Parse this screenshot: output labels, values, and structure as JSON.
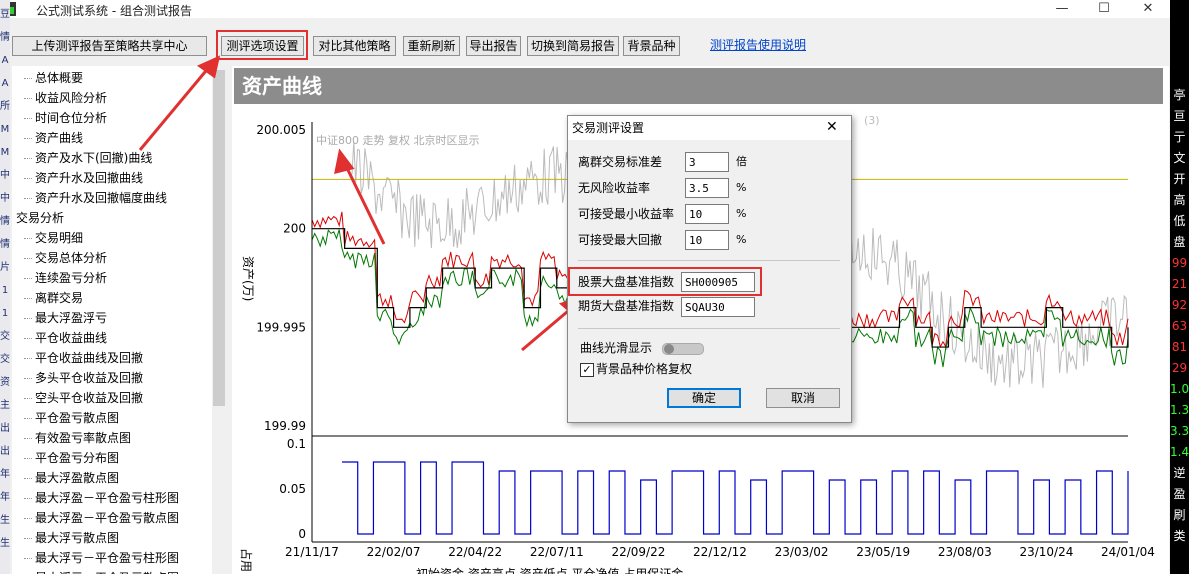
{
  "window": {
    "title": "公式测试系统 - 组合测试报告",
    "controls": {
      "minimize": "—",
      "maximize": "☐",
      "close": "✕"
    }
  },
  "left_strip": [
    "豆",
    "情",
    "A",
    "A",
    "所",
    "M",
    "M",
    "中",
    "中",
    "情",
    "情",
    "片",
    "1",
    "1",
    "交",
    "交",
    "资",
    "主",
    "出",
    "出",
    "年",
    "年",
    "生",
    "生"
  ],
  "right_strip": [
    {
      "t": "亭",
      "c": "#ffffff"
    },
    {
      "t": "亘",
      "c": "#ffffff"
    },
    {
      "t": "亍",
      "c": "#ffffff"
    },
    {
      "t": "文",
      "c": "#ffffff"
    },
    {
      "t": "开",
      "c": "#ffffff"
    },
    {
      "t": "高",
      "c": "#ffffff"
    },
    {
      "t": "低",
      "c": "#ffffff"
    },
    {
      "t": "盘",
      "c": "#ffffff"
    },
    {
      "t": "99",
      "c": "#ff3333"
    },
    {
      "t": "21",
      "c": "#ff3333"
    },
    {
      "t": "92",
      "c": "#ff3333"
    },
    {
      "t": "63",
      "c": "#ff3333"
    },
    {
      "t": "81",
      "c": "#ff3333"
    },
    {
      "t": "29",
      "c": "#ff3333"
    },
    {
      "t": "1.0",
      "c": "#33ff33"
    },
    {
      "t": "1.3",
      "c": "#33ff33"
    },
    {
      "t": "3.3",
      "c": "#33ff33"
    },
    {
      "t": "1.4",
      "c": "#33ff33"
    },
    {
      "t": "逆",
      "c": "#ffffff"
    },
    {
      "t": "盈",
      "c": "#ffffff"
    },
    {
      "t": "刷",
      "c": "#ffffff"
    },
    {
      "t": "类",
      "c": "#ffffff"
    }
  ],
  "toolbar": {
    "upload": "上传测评报告至策略共享中心",
    "options": "测评选项设置",
    "compare": "对比其他策略",
    "refresh": "重新刷新",
    "export": "导出报告",
    "simple": "切换到简易报告",
    "bg": "背景品种",
    "help": "测评报告使用说明"
  },
  "tree": {
    "items": [
      {
        "label": "总体概要",
        "level": 1
      },
      {
        "label": "收益风险分析",
        "level": 1
      },
      {
        "label": "时间仓位分析",
        "level": 1
      },
      {
        "label": "资产曲线",
        "level": 1
      },
      {
        "label": "资产及水下(回撤)曲线",
        "level": 1
      },
      {
        "label": "资产升水及回撤曲线",
        "level": 1
      },
      {
        "label": "资产升水及回撤幅度曲线",
        "level": 1
      },
      {
        "label": "交易分析",
        "level": 0
      },
      {
        "label": "交易明细",
        "level": 1
      },
      {
        "label": "交易总体分析",
        "level": 1
      },
      {
        "label": "连续盈亏分析",
        "level": 1
      },
      {
        "label": "离群交易",
        "level": 1
      },
      {
        "label": "最大浮盈浮亏",
        "level": 1
      },
      {
        "label": "平仓收益曲线",
        "level": 1
      },
      {
        "label": "平仓收益曲线及回撤",
        "level": 1
      },
      {
        "label": "多头平仓收益及回撤",
        "level": 1
      },
      {
        "label": "空头平仓收益及回撤",
        "level": 1
      },
      {
        "label": "平仓盈亏散点图",
        "level": 1
      },
      {
        "label": "有效盈亏率散点图",
        "level": 1
      },
      {
        "label": "平仓盈亏分布图",
        "level": 1
      },
      {
        "label": "最大浮盈散点图",
        "level": 1
      },
      {
        "label": "最大浮盈－平仓盈亏柱形图",
        "level": 1
      },
      {
        "label": "最大浮盈－平仓盈亏散点图",
        "level": 1
      },
      {
        "label": "最大浮亏散点图",
        "level": 1
      },
      {
        "label": "最大浮亏－平仓盈亏柱形图",
        "level": 1
      },
      {
        "label": "最大浮亏－平仓盈亏散点图",
        "level": 1
      }
    ]
  },
  "section": {
    "title": "资产曲线"
  },
  "chart_overlay": {
    "bg_label": "中证800 走势 复权 北京时区显示",
    "ylabel_main": "资产(万)",
    "ylabel_sub": "占用",
    "hidden_title_frag": "(3)"
  },
  "chart_data": [
    {
      "type": "line",
      "ylabel": "资产(万)",
      "yticks": [
        "200.005",
        "200",
        "199.995",
        "199.99"
      ],
      "ylim": [
        199.99,
        200.005
      ],
      "hline_value": 200.0025,
      "series": [
        {
          "color": "#000000",
          "values": [
            200,
            200,
            199.999,
            199.999,
            199.996,
            199.995,
            199.996,
            199.997,
            199.998,
            199.998,
            199.997,
            199.998,
            199.998,
            199.996,
            199.998,
            199.997,
            199.995,
            199.995,
            199.996,
            199.997,
            199.996,
            199.996,
            199.995,
            199.994,
            199.994,
            199.996,
            199.996,
            199.995,
            199.995,
            199.995,
            199.994,
            199.995,
            199.996,
            199.995,
            199.995,
            199.995,
            199.996,
            199.995,
            199.994,
            199.995,
            199.996,
            199.995,
            199.995,
            199.995,
            199.995,
            199.996,
            199.995,
            199.995,
            199.995,
            199.994,
            199.995
          ]
        }
      ]
    },
    {
      "type": "area",
      "yticks": [
        "0.1",
        "0.05",
        "0"
      ],
      "ylim": [
        0,
        0.1
      ],
      "xticks": [
        "21/11/17",
        "22/02/07",
        "22/04/22",
        "22/07/11",
        "22/09/22",
        "22/12/12",
        "23/03/02",
        "23/05/19",
        "23/08/03",
        "23/10/24",
        "24/01/04"
      ],
      "series": [
        {
          "color": "#0000cc",
          "values": [
            0.08,
            0,
            0.08,
            0.08,
            0,
            0.08,
            0,
            0.08,
            0.08,
            0,
            0.07,
            0,
            0.07,
            0.07,
            0,
            0.07,
            0,
            0.07,
            0,
            0.06,
            0,
            0.07,
            0.07,
            0,
            0.07,
            0,
            0.06,
            0,
            0.07,
            0.07,
            0,
            0.06,
            0,
            0.06,
            0,
            0.07,
            0,
            0.07,
            0,
            0.06,
            0,
            0.07,
            0.07,
            0,
            0.06,
            0,
            0.06,
            0,
            0.07,
            0,
            0.07
          ]
        }
      ]
    }
  ],
  "xaxis_legend": "初始资金   资产高点   资产低点   平仓净值   占用保证金",
  "dialog": {
    "title": "交易测评设置",
    "close": "✕",
    "rows": [
      {
        "label": "离群交易标准差",
        "value": "3",
        "unit": "倍"
      },
      {
        "label": "无风险收益率",
        "value": "3.5",
        "unit": "%"
      },
      {
        "label": "可接受最小收益率",
        "value": "10",
        "unit": "%"
      },
      {
        "label": "可接受最大回撤",
        "value": "10",
        "unit": "%"
      }
    ],
    "stock_index_label": "股票大盘基准指数",
    "stock_index_value": "SH000905",
    "futures_index_label": "期货大盘基准指数",
    "futures_index_value": "SQAU30",
    "smooth_label": "曲线光滑显示",
    "smooth_on": false,
    "bg_restore_label": "背景品种价格复权",
    "bg_restore_checked": true,
    "ok": "确定",
    "cancel": "取消"
  },
  "colors": {
    "annotation_red": "#e03030",
    "asset_red": "#dd0000",
    "asset_green": "#007700",
    "margin_blue": "#0000cc",
    "baseline_yellow": "#c8b400",
    "bg_gray": "#bbbbbb"
  }
}
